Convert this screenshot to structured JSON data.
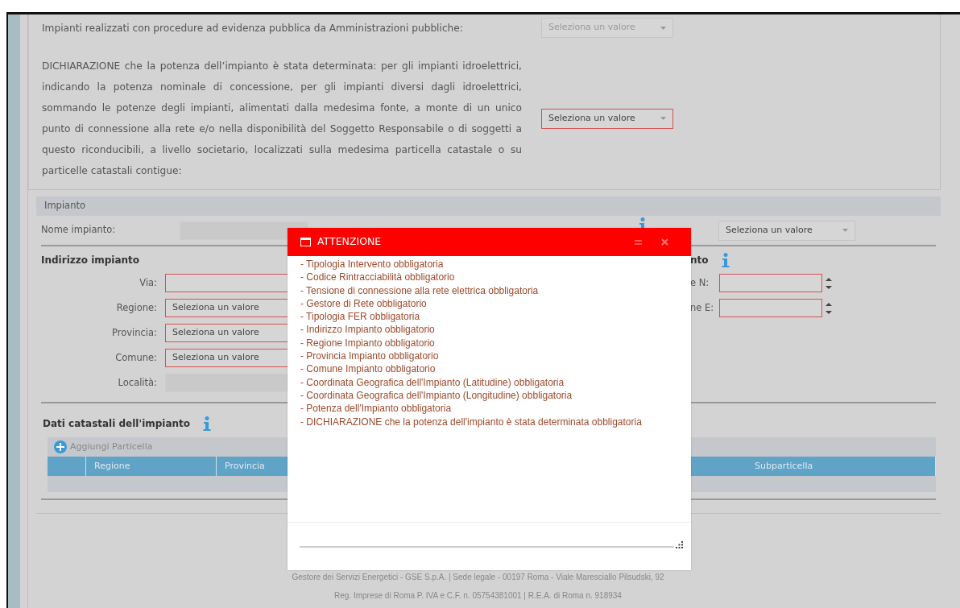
{
  "declarations": [
    {
      "text": "Impianti realizzati con procedure ad evidenza pubblica da Amministrazioni pubbliche:",
      "select": {
        "value": "Seleziona un valore",
        "disabled": true,
        "invalid": false
      }
    },
    {
      "text": "DICHIARAZIONE che la potenza dell’impianto è stata determinata: per gli impianti idroelettrici, indicando la potenza nominale di concessione, per gli impianti diversi dagli idroelettrici, sommando le potenze degli impianti, alimentati dalla medesima fonte, a monte di un unico punto di connessione alla rete e/o nella disponibilità del Soggetto Responsabile o di soggetti a questo riconducibili, a livello societario, localizzati sulla medesima particella catastale o su particelle catastali contigue:",
      "select": {
        "value": "Seleziona un valore",
        "disabled": false,
        "invalid": true
      }
    }
  ],
  "impianto": {
    "title": "Impianto",
    "nome_label": "Nome impianto:",
    "ibrido_select": "Seleziona un valore",
    "indirizzo_title": "Indirizzo impianto",
    "address_fields": [
      {
        "label": "Via:",
        "kind": "input",
        "disabled": false,
        "invalid": true
      },
      {
        "label": "Regione:",
        "kind": "select",
        "value": "Seleziona un valore",
        "disabled": false,
        "invalid": true
      },
      {
        "label": "Provincia:",
        "kind": "select",
        "value": "Seleziona un valore",
        "disabled": false,
        "invalid": true
      },
      {
        "label": "Comune:",
        "kind": "select",
        "value": "Seleziona un valore",
        "disabled": false,
        "invalid": true
      },
      {
        "label": "Località:",
        "kind": "input",
        "disabled": true,
        "invalid": false
      }
    ],
    "coord_title": "nto",
    "coord_fields": [
      {
        "label": "e N:",
        "invalid": true
      },
      {
        "label": "ne E:",
        "invalid": true
      }
    ],
    "catasto_title": "Dati catastali dell'impianto",
    "add_button": "Aggiungi Particella",
    "table_columns": [
      "Regione",
      "Provincia",
      "Subparticella"
    ]
  },
  "dialog": {
    "title": "ATTENZIONE",
    "messages": [
      "- Tipologia Intervento obbligatoria",
      "- Codice Rintracciabilità obbligatorio",
      "- Tensione di connessione alla rete elettrica obbligatoria",
      "- Gestore di Rete obbligatorio",
      "- Tipologia FER obbligatoria",
      "- Indirizzo Impianto obbligatorio",
      "- Regione Impianto obbligatorio",
      "- Provincia Impianto obbligatorio",
      "- Comune Impianto obbligatorio",
      "- Coordinata Geografica dell'Impianto (Latitudine) obbligatoria",
      "- Coordinata Geografica dell'Impianto (Longitudine) obbligatoria",
      "- Potenza dell'Impianto obbligatoria",
      "- DICHIARAZIONE che la potenza dell'impianto è stata determinata obbligatoria"
    ]
  },
  "footer": [
    "Gestore dei Servizi Energetici - GSE S.p.A. | Sede legale - 00197 Roma - Viale Maresciallo Pilsudski, 92",
    "Reg. Imprese di Roma P. IVA e C.F. n. 05754381001 | R.E.A. di Roma n. 918934"
  ]
}
